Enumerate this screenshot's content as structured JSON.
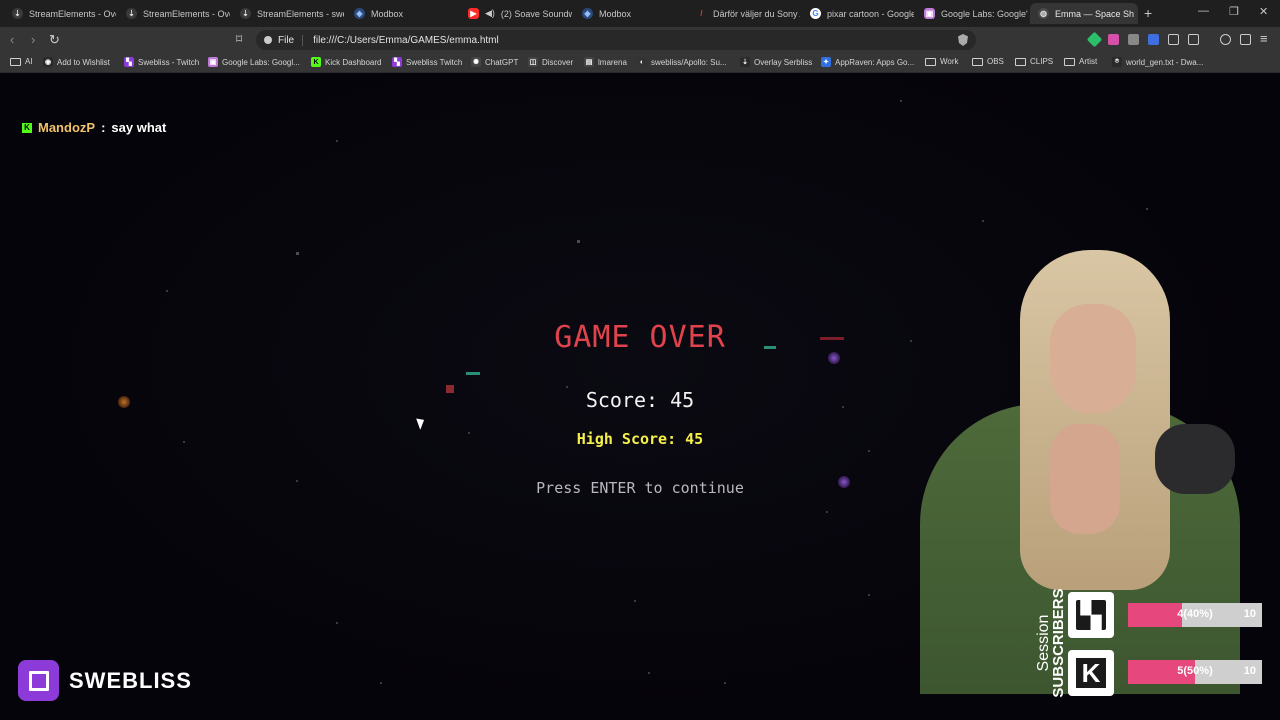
{
  "browser": {
    "tabs": [
      {
        "title": "StreamElements - Ove",
        "color": "#d0d0d0"
      },
      {
        "title": "StreamElements - Ove",
        "color": "#d0d0d0"
      },
      {
        "title": "StreamElements - swe",
        "color": "#d0d0d0"
      },
      {
        "title": "Modbox",
        "color": "#7fb0ff"
      },
      {
        "title": "(2) Soave Soundw",
        "color": "#ff2b2b"
      },
      {
        "title": "Modbox",
        "color": "#7fb0ff"
      },
      {
        "title": "Därför väljer du Sony A",
        "color": "#e53935"
      },
      {
        "title": "pixar cartoon - Google",
        "color": "#ffffff"
      },
      {
        "title": "Google Labs: Google's",
        "color": "#c07ad8"
      },
      {
        "title": "Emma — Space Sh",
        "color": "#d0d0d0"
      }
    ],
    "new_tab": "+",
    "address": {
      "scheme_label": "File",
      "url": "file:///C:/Users/Emma/GAMES/emma.html"
    },
    "bookmarks": [
      {
        "label": "AI",
        "type": "folder"
      },
      {
        "label": "Add to Wishlist",
        "type": "link"
      },
      {
        "label": "Swebliss - Twitch",
        "type": "link"
      },
      {
        "label": "Google Labs: Googl...",
        "type": "link"
      },
      {
        "label": "Kick Dashboard",
        "type": "link"
      },
      {
        "label": "Swebliss Twitch",
        "type": "link"
      },
      {
        "label": "ChatGPT",
        "type": "link"
      },
      {
        "label": "Discover",
        "type": "link"
      },
      {
        "label": "lmarena",
        "type": "link"
      },
      {
        "label": "swebliss/Apollo: Su...",
        "type": "link"
      },
      {
        "label": "Overlay Serbliss",
        "type": "link"
      },
      {
        "label": "AppRaven: Apps Go...",
        "type": "link"
      },
      {
        "label": "Work",
        "type": "folder"
      },
      {
        "label": "OBS",
        "type": "folder"
      },
      {
        "label": "CLIPS",
        "type": "folder"
      },
      {
        "label": "Artist",
        "type": "folder"
      },
      {
        "label": "world_gen.txt - Dwa...",
        "type": "link"
      }
    ]
  },
  "chat": {
    "platform_icon": "kick-icon",
    "username": "MandozP",
    "separator": ":",
    "message": "say what"
  },
  "game": {
    "title": "GAME OVER",
    "score_text": "Score: 45",
    "high_score_text": "High Score: 45",
    "prompt": "Press ENTER to continue",
    "score": 45,
    "high_score": 45,
    "colors": {
      "title": "#e0434b",
      "high_score": "#f5f04a"
    }
  },
  "session": {
    "label_top": "Session",
    "label_bottom": "SUBSCRIBERS",
    "rows": [
      {
        "platform": "twitch-icon",
        "progress_text": "4(40%)",
        "goal": "10",
        "fraction": 0.4
      },
      {
        "platform": "kick-icon",
        "progress_text": "5(50%)",
        "goal": "10",
        "fraction": 0.5
      }
    ],
    "bar_color": "#e6487d"
  },
  "brand": {
    "name": "SWEBLISS",
    "icon": "twitch-icon",
    "color": "#8d3bd8"
  }
}
